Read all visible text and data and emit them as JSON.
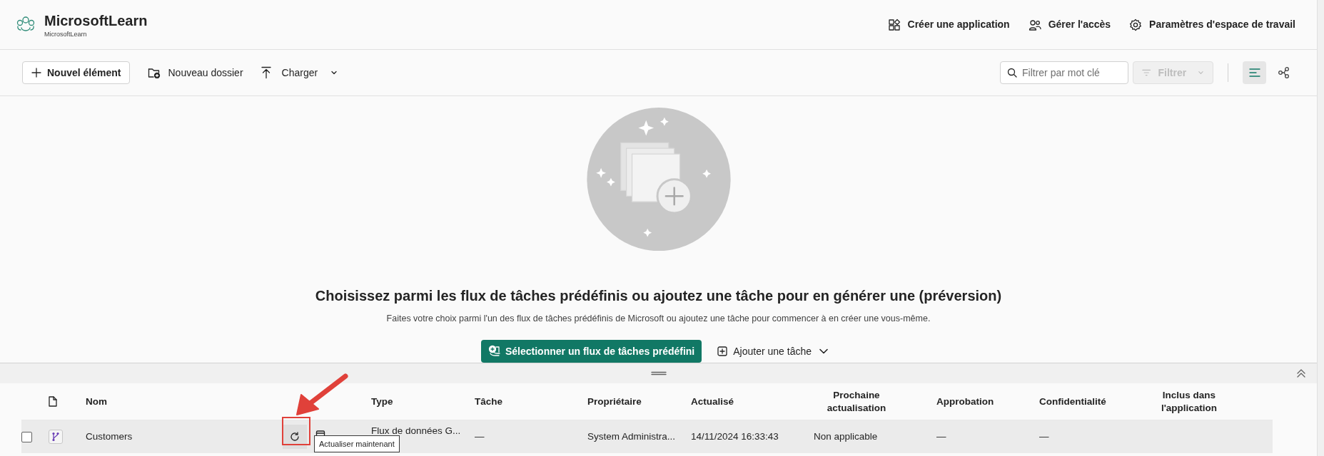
{
  "workspace": {
    "title": "MicrosoftLearn",
    "subtitle": "MicrosoftLearn"
  },
  "header_actions": [
    "Créer une application",
    "Gérer l'accès",
    "Paramètres d'espace de travail"
  ],
  "toolbar": {
    "new_item": "Nouvel élément",
    "new_folder": "Nouveau dossier",
    "upload": "Charger",
    "filter_placeholder": "Filtrer par mot clé",
    "filter_button": {
      "label": "Filtrer",
      "disabled": true
    },
    "views": [
      {
        "selected": true
      },
      {
        "selected": false
      }
    ]
  },
  "empty_state": {
    "title": "Choisissez parmi les flux de tâches prédéfinis ou ajoutez une tâche pour en générer une (préversion)",
    "description": "Faites votre choix parmi l'un des flux de tâches prédéfinis de Microsoft ou ajoutez une tâche pour commencer à en créer une vous-même.",
    "primary_button": "Sélectionner un flux de tâches prédéfini",
    "secondary_button": "Ajouter une tâche"
  },
  "table": {
    "columns": [
      "Nom",
      "Type",
      "Tâche",
      "Propriétaire",
      "Actualisé",
      "Prochaine actualisation",
      "Approbation",
      "Confidentialité",
      "Inclus dans l'application"
    ],
    "rows": [
      {
        "checked": false,
        "hovered": true,
        "name": "Customers",
        "type": "Flux de données G...",
        "task": "—",
        "owner": "System Administra...",
        "refreshed": "14/11/2024 16:33:43",
        "next_refresh": "Non applicable",
        "approval": "—",
        "sensitivity": "—"
      }
    ]
  },
  "tooltip": "Actualiser maintenant"
}
